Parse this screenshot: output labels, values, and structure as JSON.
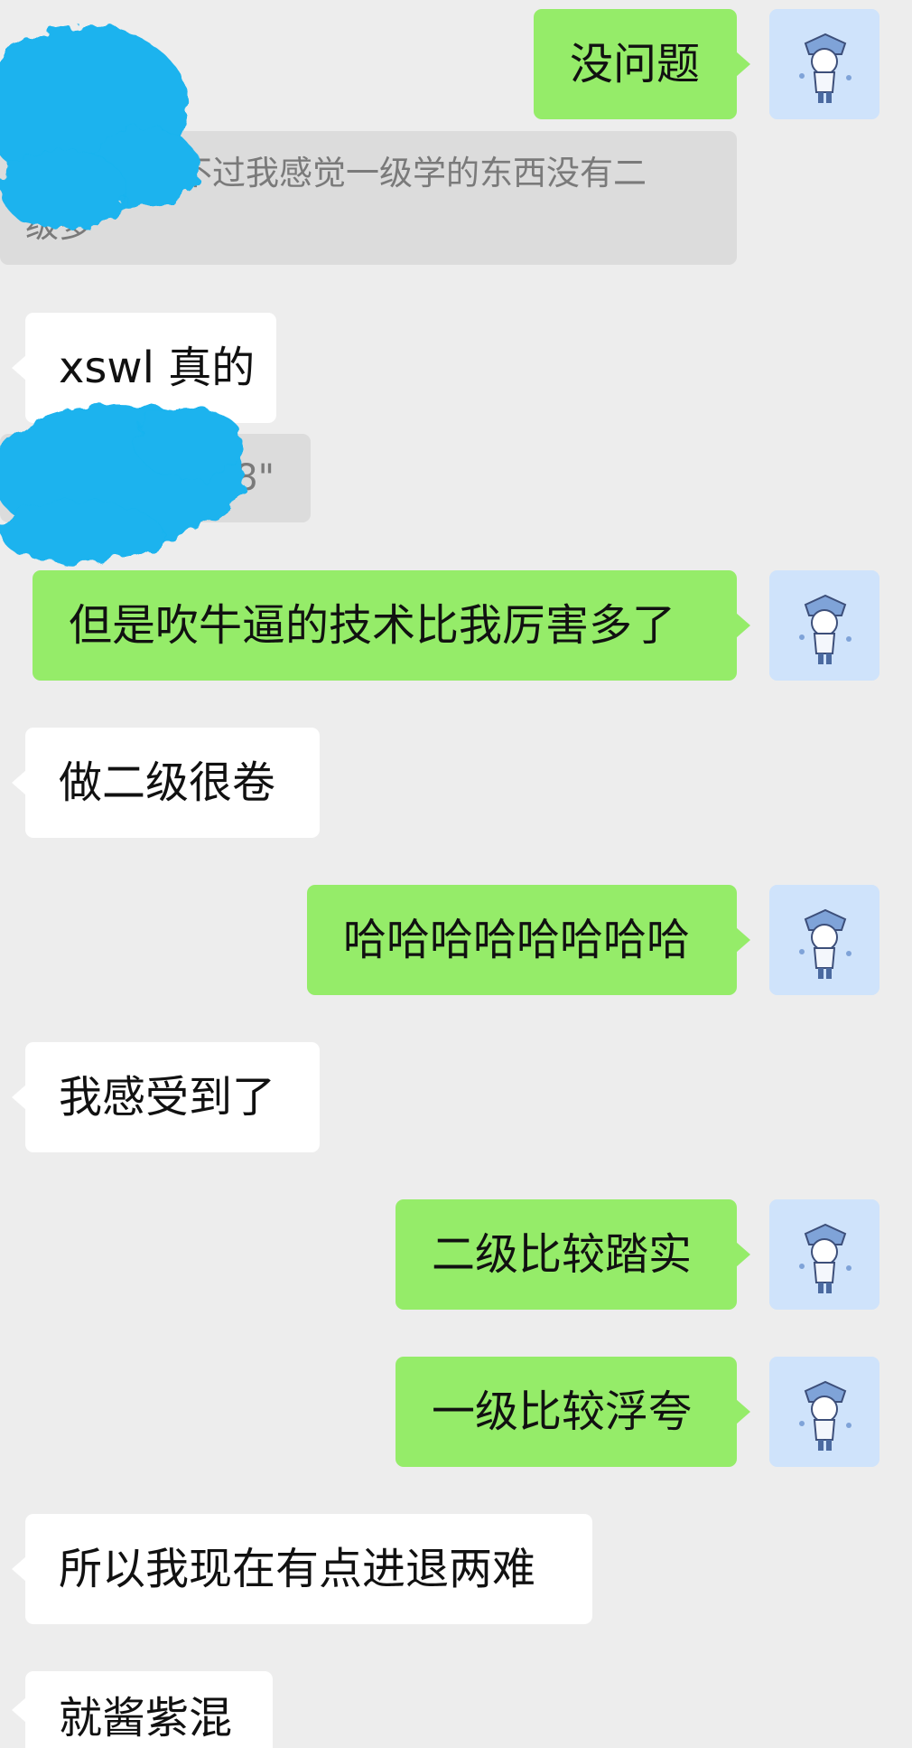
{
  "messages": {
    "m1": "没问题",
    "quote_text_line1": "不过我感觉一级学的东西没有二",
    "quote_text_line2": "级多",
    "m2": "xswl 真的",
    "voice_duration": "8\"",
    "m3": "但是吹牛逼的技术比我厉害多了",
    "m4": "做二级很卷",
    "m5": "哈哈哈哈哈哈哈哈",
    "m6": "我感受到了",
    "m7": "二级比较踏实",
    "m8": "一级比较浮夸",
    "m9": "所以我现在有点进退两难",
    "m10": "就酱紫混"
  },
  "icons": {
    "avatar": "anime-character-avatar",
    "voice": "voice-wave-icon"
  },
  "colors": {
    "background": "#ededed",
    "sent_bubble": "#95ec69",
    "received_bubble": "#ffffff",
    "quote_bubble": "#dcdcdc",
    "redaction": "#1ab3ee"
  }
}
